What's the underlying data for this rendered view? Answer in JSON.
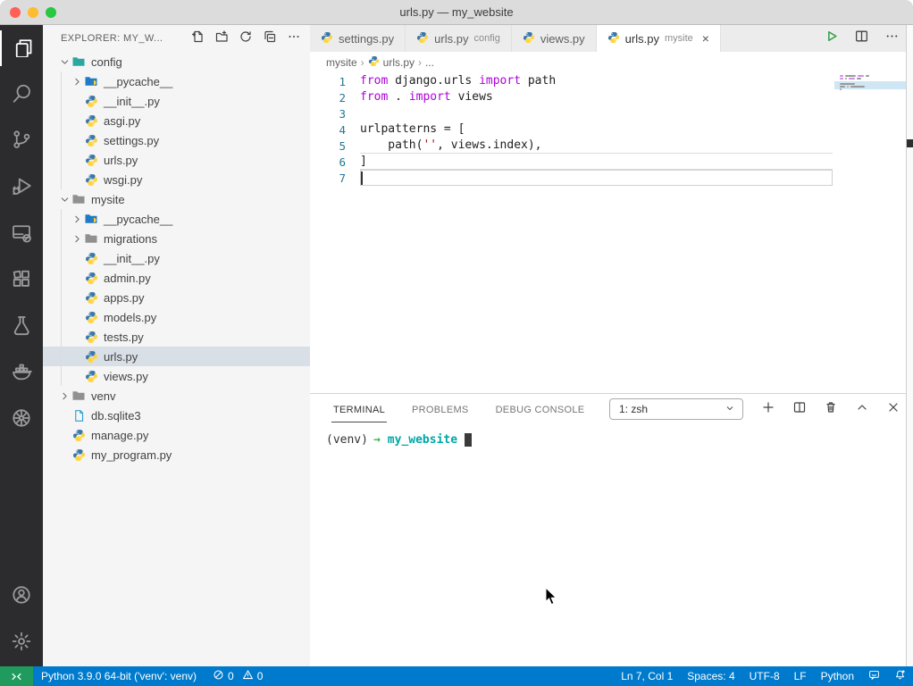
{
  "window": {
    "title": "urls.py — my_website"
  },
  "activity_bar": {
    "top": [
      {
        "name": "explorer",
        "active": true
      },
      {
        "name": "search",
        "active": false
      },
      {
        "name": "source-control",
        "active": false
      },
      {
        "name": "run-debug",
        "active": false
      },
      {
        "name": "remote-explorer",
        "active": false
      },
      {
        "name": "extensions",
        "active": false
      },
      {
        "name": "testing",
        "active": false
      },
      {
        "name": "docker",
        "active": false
      },
      {
        "name": "kubernetes",
        "active": false
      }
    ],
    "bottom": [
      {
        "name": "account",
        "active": false
      },
      {
        "name": "settings",
        "active": false
      }
    ]
  },
  "explorer": {
    "title": "EXPLORER: MY_W...",
    "actions": [
      "new-file",
      "new-folder",
      "refresh",
      "collapse-all",
      "more"
    ],
    "tree": [
      {
        "label": "config",
        "kind": "folder",
        "color": "#2aa7a0",
        "depth": 0,
        "expanded": true,
        "selected": false
      },
      {
        "label": "__pycache__",
        "kind": "folder",
        "color": "#1f7ac7",
        "depth": 1,
        "expanded": false,
        "selected": false
      },
      {
        "label": "__init__.py",
        "kind": "python",
        "depth": 1,
        "selected": false
      },
      {
        "label": "asgi.py",
        "kind": "python",
        "depth": 1,
        "selected": false
      },
      {
        "label": "settings.py",
        "kind": "python",
        "depth": 1,
        "selected": false
      },
      {
        "label": "urls.py",
        "kind": "python",
        "depth": 1,
        "selected": false
      },
      {
        "label": "wsgi.py",
        "kind": "python",
        "depth": 1,
        "selected": false
      },
      {
        "label": "mysite",
        "kind": "folder",
        "color": "#90908f",
        "depth": 0,
        "expanded": true,
        "selected": false
      },
      {
        "label": "__pycache__",
        "kind": "folder",
        "color": "#1f7ac7",
        "depth": 1,
        "expanded": false,
        "selected": false
      },
      {
        "label": "migrations",
        "kind": "folder",
        "color": "#90908f",
        "depth": 1,
        "expanded": false,
        "selected": false
      },
      {
        "label": "__init__.py",
        "kind": "python",
        "depth": 1,
        "selected": false
      },
      {
        "label": "admin.py",
        "kind": "python",
        "depth": 1,
        "selected": false
      },
      {
        "label": "apps.py",
        "kind": "python",
        "depth": 1,
        "selected": false
      },
      {
        "label": "models.py",
        "kind": "python",
        "depth": 1,
        "selected": false
      },
      {
        "label": "tests.py",
        "kind": "python",
        "depth": 1,
        "selected": false
      },
      {
        "label": "urls.py",
        "kind": "python",
        "depth": 1,
        "selected": true
      },
      {
        "label": "views.py",
        "kind": "python",
        "depth": 1,
        "selected": false
      },
      {
        "label": "venv",
        "kind": "folder",
        "color": "#90908f",
        "depth": 0,
        "expanded": false,
        "selected": false
      },
      {
        "label": "db.sqlite3",
        "kind": "database",
        "depth": 0,
        "selected": false
      },
      {
        "label": "manage.py",
        "kind": "python",
        "depth": 0,
        "selected": false
      },
      {
        "label": "my_program.py",
        "kind": "python",
        "depth": 0,
        "selected": false
      }
    ]
  },
  "editor_tabs": [
    {
      "label": "settings.py",
      "detail": "",
      "active": false,
      "closable": false
    },
    {
      "label": "urls.py",
      "detail": "config",
      "active": false,
      "closable": false
    },
    {
      "label": "views.py",
      "detail": "",
      "active": false,
      "closable": false
    },
    {
      "label": "urls.py",
      "detail": "mysite",
      "active": true,
      "closable": true
    }
  ],
  "editor_actions": [
    "run",
    "split-editor",
    "more"
  ],
  "breadcrumb": {
    "items": [
      {
        "label": "mysite",
        "icon": ""
      },
      {
        "label": "urls.py",
        "icon": "python"
      },
      {
        "label": "...",
        "icon": ""
      }
    ],
    "separator": "›"
  },
  "code": {
    "cursor_line": 7,
    "lines": [
      {
        "n": "1",
        "tokens": [
          [
            "kw",
            "from"
          ],
          [
            "pl",
            " django.urls "
          ],
          [
            "kw",
            "import"
          ],
          [
            "pl",
            " path"
          ]
        ]
      },
      {
        "n": "2",
        "tokens": [
          [
            "kw",
            "from"
          ],
          [
            "pl",
            " . "
          ],
          [
            "kw",
            "import"
          ],
          [
            "pl",
            " views"
          ]
        ]
      },
      {
        "n": "3",
        "tokens": []
      },
      {
        "n": "4",
        "tokens": [
          [
            "pl",
            "urlpatterns = ["
          ]
        ]
      },
      {
        "n": "5",
        "tokens": [
          [
            "pl",
            "    path("
          ],
          [
            "str",
            "''"
          ],
          [
            "pl",
            ", views.index),"
          ]
        ]
      },
      {
        "n": "6",
        "tokens": [
          [
            "pl",
            "]"
          ]
        ]
      },
      {
        "n": "7",
        "tokens": []
      }
    ]
  },
  "terminal": {
    "tabs": [
      {
        "label": "TERMINAL",
        "active": true
      },
      {
        "label": "PROBLEMS",
        "active": false
      },
      {
        "label": "DEBUG CONSOLE",
        "active": false
      }
    ],
    "shell": "1: zsh",
    "actions": [
      "new-terminal",
      "split-terminal",
      "kill-terminal",
      "maximize-panel",
      "close-panel"
    ],
    "prompt": {
      "env": "(venv)",
      "arrow": "→",
      "cwd": "my_website"
    }
  },
  "status_bar": {
    "python_version": "Python 3.9.0 64-bit ('venv': venv)",
    "errors": "0",
    "warnings": "0",
    "right_items": [
      "Ln 7, Col 1",
      "Spaces: 4",
      "UTF-8",
      "LF",
      "Python"
    ]
  },
  "colors": {
    "accent": "#007acc",
    "remote_green": "#1f9c5d",
    "keyword": "#af00db",
    "string": "#a31515",
    "line_number": "#237893",
    "prompt_arrow": "#3cb44b",
    "terminal_cwd": "#00a7a7",
    "traffic": [
      "#ff5f57",
      "#febc2e",
      "#28c840"
    ]
  }
}
